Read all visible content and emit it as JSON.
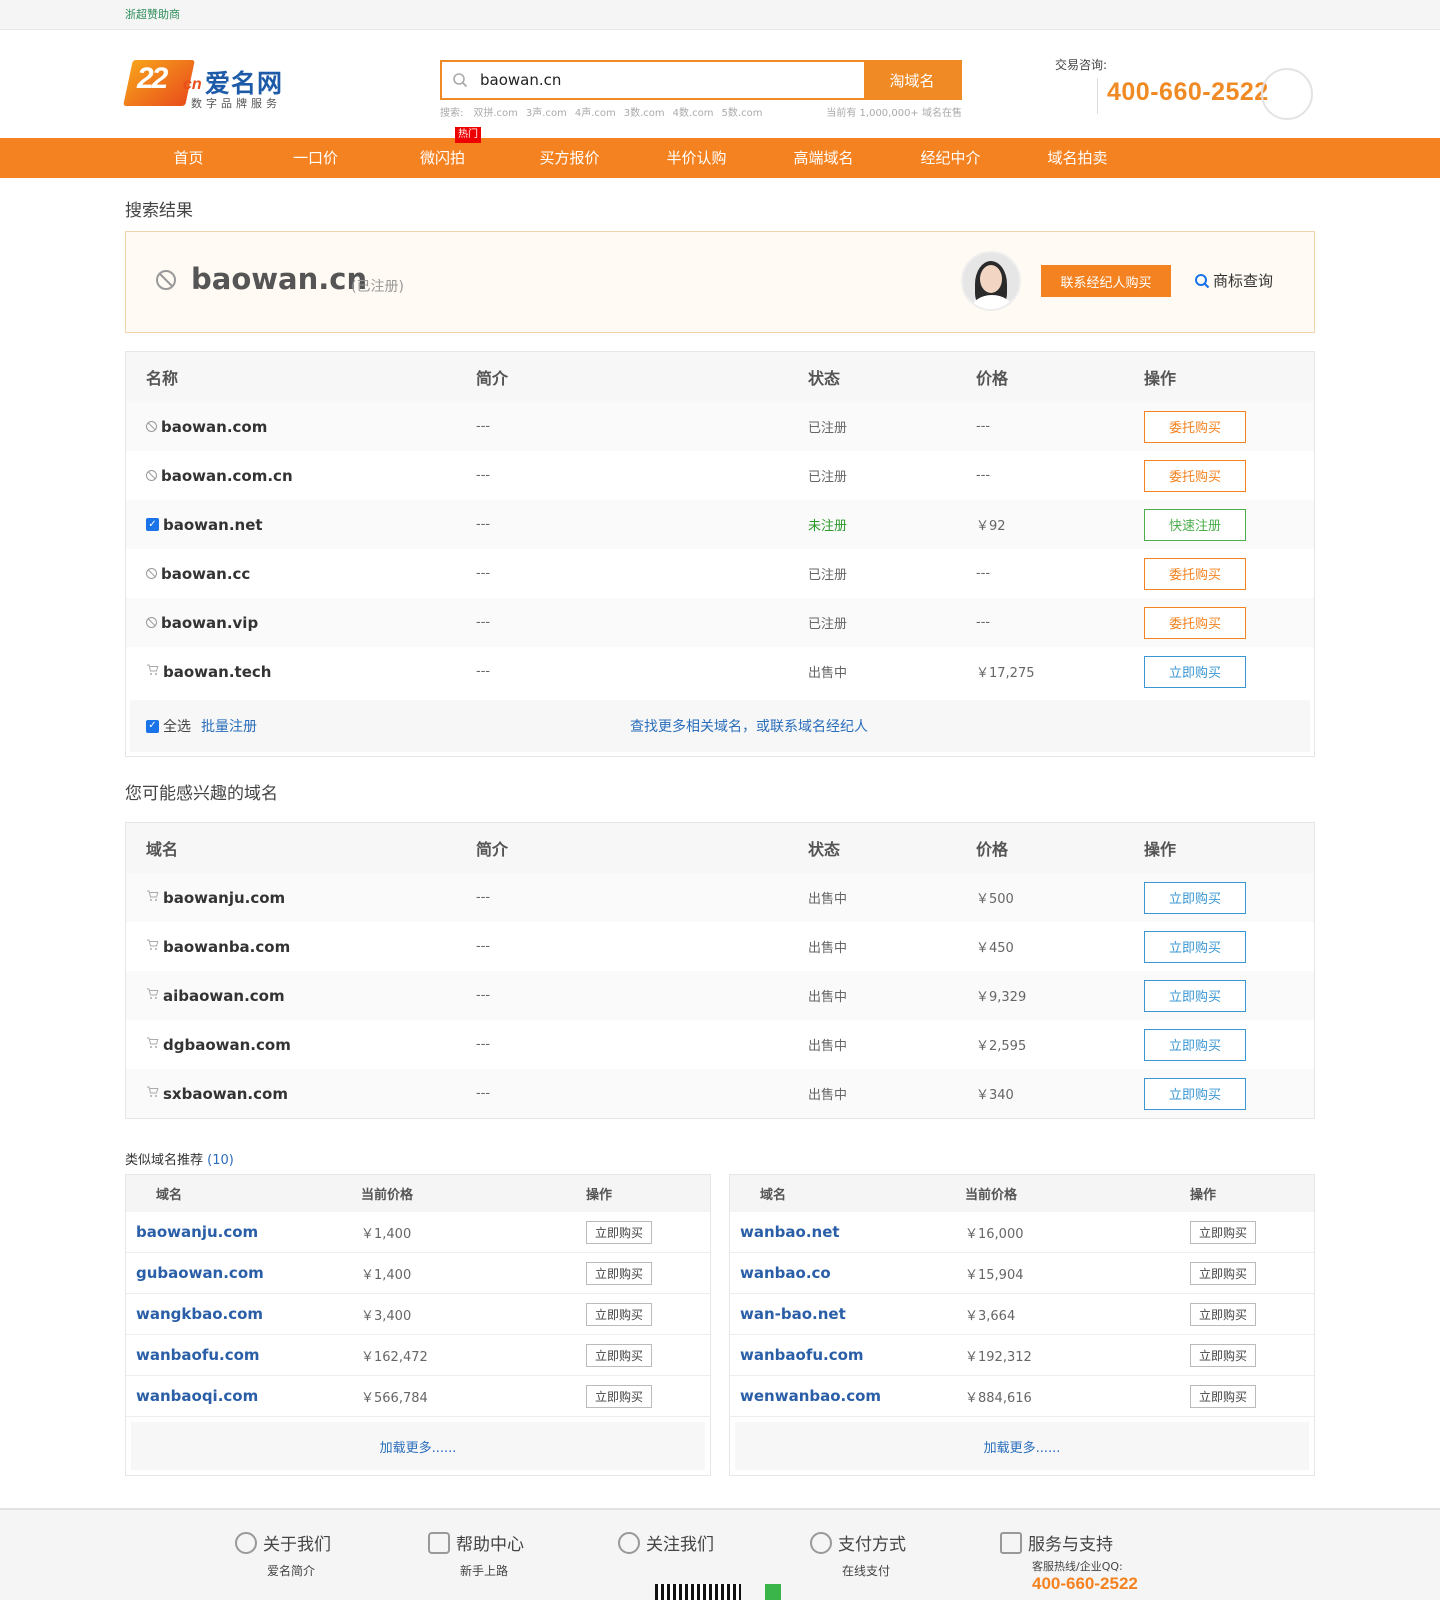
{
  "topbar": {
    "sponsor": "浙超赞助商"
  },
  "header": {
    "logo_mark": "22",
    "logo_cn": "cn",
    "logo_brand": "爱名网",
    "logo_slogan": "数字品牌服务",
    "search_value": "baowan.cn",
    "search_button": "淘域名",
    "hint_label": "搜索:",
    "hints": [
      "双拼.com",
      "3声.com",
      "4声.com",
      "3数.com",
      "4数.com",
      "5数.com"
    ],
    "hint_right": "当前有 1,000,000+ 域名在售",
    "hotline_label": "交易咨询:",
    "hotline_number": "400-660-2522"
  },
  "nav": {
    "items": [
      "首页",
      "一口价",
      "微闪拍",
      "买方报价",
      "半价认购",
      "高端域名",
      "经纪中介",
      "域名拍卖"
    ],
    "hot_badge": "热门"
  },
  "result": {
    "section_title": "搜索结果",
    "domain": "baowan.cn",
    "status": "(已注册)",
    "contact_button": "联系经纪人购买",
    "trademark_link": "商标查询"
  },
  "results_table": {
    "headers": [
      "名称",
      "简介",
      "状态",
      "价格",
      "操作"
    ],
    "rows": [
      {
        "icon": "ban",
        "name": "baowan.com",
        "intro": "---",
        "status": "已注册",
        "price": "---",
        "action": "委托购买",
        "btn": "orange"
      },
      {
        "icon": "ban",
        "name": "baowan.com.cn",
        "intro": "---",
        "status": "已注册",
        "price": "---",
        "action": "委托购买",
        "btn": "orange"
      },
      {
        "icon": "check",
        "name": "baowan.net",
        "intro": "---",
        "status": "未注册",
        "price": "￥92",
        "action": "快速注册",
        "btn": "green"
      },
      {
        "icon": "ban",
        "name": "baowan.cc",
        "intro": "---",
        "status": "已注册",
        "price": "---",
        "action": "委托购买",
        "btn": "orange"
      },
      {
        "icon": "ban",
        "name": "baowan.vip",
        "intro": "---",
        "status": "已注册",
        "price": "---",
        "action": "委托购买",
        "btn": "orange"
      },
      {
        "icon": "cart",
        "name": "baowan.tech",
        "intro": "---",
        "status": "出售中",
        "price": "￥17,275",
        "action": "立即购买",
        "btn": "blue"
      }
    ],
    "select_all": "全选",
    "batch_register": "批量注册",
    "find_more": "查找更多相关域名，或联系域名经纪人"
  },
  "interest": {
    "section_title": "您可能感兴趣的域名",
    "headers": [
      "域名",
      "简介",
      "状态",
      "价格",
      "操作"
    ],
    "rows": [
      {
        "name": "baowanju.com",
        "intro": "---",
        "status": "出售中",
        "price": "￥500",
        "action": "立即购买"
      },
      {
        "name": "baowanba.com",
        "intro": "---",
        "status": "出售中",
        "price": "￥450",
        "action": "立即购买"
      },
      {
        "name": "aibaowan.com",
        "intro": "---",
        "status": "出售中",
        "price": "￥9,329",
        "action": "立即购买"
      },
      {
        "name": "dgbaowan.com",
        "intro": "---",
        "status": "出售中",
        "price": "￥2,595",
        "action": "立即购买"
      },
      {
        "name": "sxbaowan.com",
        "intro": "---",
        "status": "出售中",
        "price": "￥340",
        "action": "立即购买"
      }
    ]
  },
  "similar": {
    "title": "类似域名推荐",
    "count": "(10)",
    "headers": [
      "域名",
      "当前价格",
      "操作"
    ],
    "left": [
      {
        "name": "baowanju.com",
        "price": "￥1,400",
        "action": "立即购买"
      },
      {
        "name": "gubaowan.com",
        "price": "￥1,400",
        "action": "立即购买"
      },
      {
        "name": "wangkbao.com",
        "price": "￥3,400",
        "action": "立即购买"
      },
      {
        "name": "wanbaofu.com",
        "price": "￥162,472",
        "action": "立即购买"
      },
      {
        "name": "wanbaoqi.com",
        "price": "￥566,784",
        "action": "立即购买"
      }
    ],
    "right": [
      {
        "name": "wanbao.net",
        "price": "￥16,000",
        "action": "立即购买"
      },
      {
        "name": "wanbao.co",
        "price": "￥15,904",
        "action": "立即购买"
      },
      {
        "name": "wan-bao.net",
        "price": "￥3,664",
        "action": "立即购买"
      },
      {
        "name": "wanbaofu.com",
        "price": "￥192,312",
        "action": "立即购买"
      },
      {
        "name": "wenwanbao.com",
        "price": "￥884,616",
        "action": "立即购买"
      }
    ],
    "load_more": "加载更多......"
  },
  "footer": {
    "cols": [
      {
        "title": "关于我们",
        "sub": "爱名简介"
      },
      {
        "title": "帮助中心",
        "sub": "新手上路"
      },
      {
        "title": "关注我们",
        "sub": ""
      },
      {
        "title": "支付方式",
        "sub": "在线支付"
      },
      {
        "title": "服务与支持",
        "sub": "客服热线/企业QQ:"
      }
    ],
    "support_number": "400-660-2522"
  }
}
